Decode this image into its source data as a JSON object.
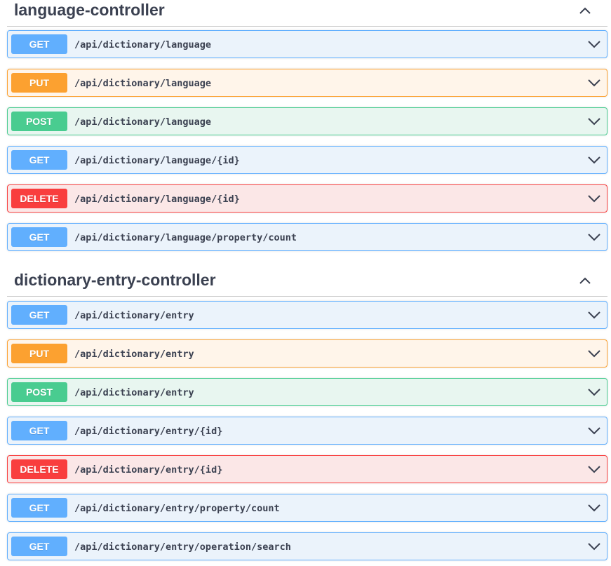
{
  "colors": {
    "get": "#61affe",
    "put": "#fca130",
    "post": "#49cc90",
    "delete": "#f93e3e",
    "text": "#3b4151"
  },
  "sections": [
    {
      "title": "language-controller",
      "collapse_icon": "chevron-up-icon",
      "operations": [
        {
          "method": "GET",
          "path": "/api/dictionary/language"
        },
        {
          "method": "PUT",
          "path": "/api/dictionary/language"
        },
        {
          "method": "POST",
          "path": "/api/dictionary/language"
        },
        {
          "method": "GET",
          "path": "/api/dictionary/language/{id}"
        },
        {
          "method": "DELETE",
          "path": "/api/dictionary/language/{id}"
        },
        {
          "method": "GET",
          "path": "/api/dictionary/language/property/count"
        }
      ]
    },
    {
      "title": "dictionary-entry-controller",
      "collapse_icon": "chevron-up-icon",
      "operations": [
        {
          "method": "GET",
          "path": "/api/dictionary/entry"
        },
        {
          "method": "PUT",
          "path": "/api/dictionary/entry"
        },
        {
          "method": "POST",
          "path": "/api/dictionary/entry"
        },
        {
          "method": "GET",
          "path": "/api/dictionary/entry/{id}"
        },
        {
          "method": "DELETE",
          "path": "/api/dictionary/entry/{id}"
        },
        {
          "method": "GET",
          "path": "/api/dictionary/entry/property/count"
        },
        {
          "method": "GET",
          "path": "/api/dictionary/entry/operation/search"
        }
      ]
    }
  ]
}
